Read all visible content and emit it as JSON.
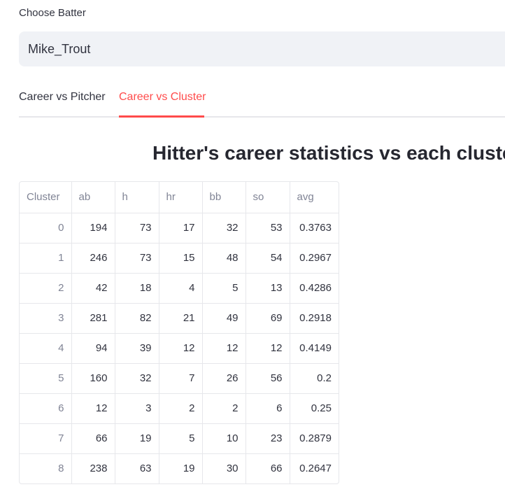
{
  "selector": {
    "label": "Choose Batter",
    "value": "Mike_Trout"
  },
  "tabs": [
    {
      "label": "Career vs Pitcher",
      "active": false
    },
    {
      "label": "Career vs Cluster",
      "active": true
    }
  ],
  "heading": "Hitter's career statistics vs each cluster",
  "colors": {
    "accent": "#ff4b4b",
    "select_bg": "#f0f2f6",
    "border": "#e6e7eb",
    "muted_text": "#808495"
  },
  "table": {
    "columns": [
      "Cluster",
      "ab",
      "h",
      "hr",
      "bb",
      "so",
      "avg"
    ],
    "rows": [
      [
        "0",
        "194",
        "73",
        "17",
        "32",
        "53",
        "0.3763"
      ],
      [
        "1",
        "246",
        "73",
        "15",
        "48",
        "54",
        "0.2967"
      ],
      [
        "2",
        "42",
        "18",
        "4",
        "5",
        "13",
        "0.4286"
      ],
      [
        "3",
        "281",
        "82",
        "21",
        "49",
        "69",
        "0.2918"
      ],
      [
        "4",
        "94",
        "39",
        "12",
        "12",
        "12",
        "0.4149"
      ],
      [
        "5",
        "160",
        "32",
        "7",
        "26",
        "56",
        "0.2"
      ],
      [
        "6",
        "12",
        "3",
        "2",
        "2",
        "6",
        "0.25"
      ],
      [
        "7",
        "66",
        "19",
        "5",
        "10",
        "23",
        "0.2879"
      ],
      [
        "8",
        "238",
        "63",
        "19",
        "30",
        "66",
        "0.2647"
      ]
    ]
  }
}
